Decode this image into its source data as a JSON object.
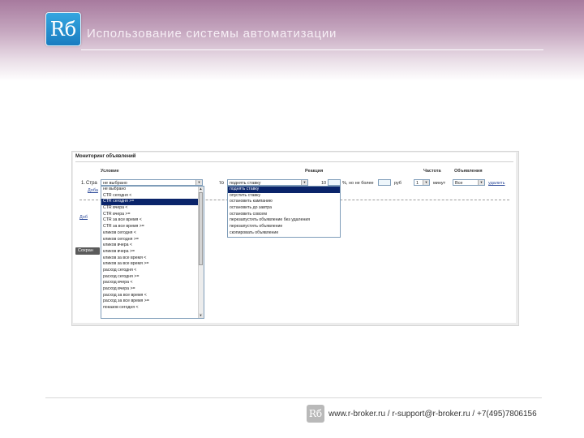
{
  "slide": {
    "title": "Использование системы автоматизации",
    "logo_text": "Rб",
    "footer_logo_text": "Rб",
    "footer": "www.r-broker.ru / r-support@r-broker.ru / +7(495)7806156"
  },
  "panel": {
    "title": "Мониторинг объявлений",
    "headers": {
      "condition": "Условие",
      "action": "Реакция",
      "frequency": "Частота",
      "ads": "Объявления"
    },
    "row_number": "1.",
    "row_prefix": "Стра",
    "condition_value": "не выбрано",
    "to_label": "то",
    "action_value": "поднять ставку",
    "amount_value": "10",
    "currency_note": "%, но не более",
    "rub_label": "руб",
    "period_value": "1",
    "period_unit": "минут",
    "ads_value": "Все",
    "delete_link": "удалить",
    "add_link": "Доба",
    "add_link_2": "Доб",
    "save_label": "Сохран"
  },
  "condition_options": [
    "не выбрано",
    "CTR сегодня <",
    "CTR сегодня >=",
    "CTR вчера <",
    "CTR вчера >=",
    "CTR за все время <",
    "CTR за все время >=",
    "кликов сегодня <",
    "кликов сегодня >=",
    "кликов вчера <",
    "кликов вчера >=",
    "кликов за все время <",
    "кликов за все время >=",
    "расход сегодня <",
    "расход сегодня >=",
    "расход вчера <",
    "расход вчера >=",
    "расход за все время <",
    "расход за все время >=",
    "показов сегодня <"
  ],
  "condition_selected_index": 2,
  "action_options": [
    "поднять ставку",
    "опустить ставку",
    "остановить кампанию",
    "остановить до завтра",
    "остановить совсем",
    "перезапустить объявление без удаления",
    "перезапустить объявление",
    "скопировать объявление"
  ],
  "action_selected_index": 0,
  "colors": {
    "header_band": "#a77a9e",
    "selection": "#0a246a",
    "logo": "#1a7cc0"
  }
}
